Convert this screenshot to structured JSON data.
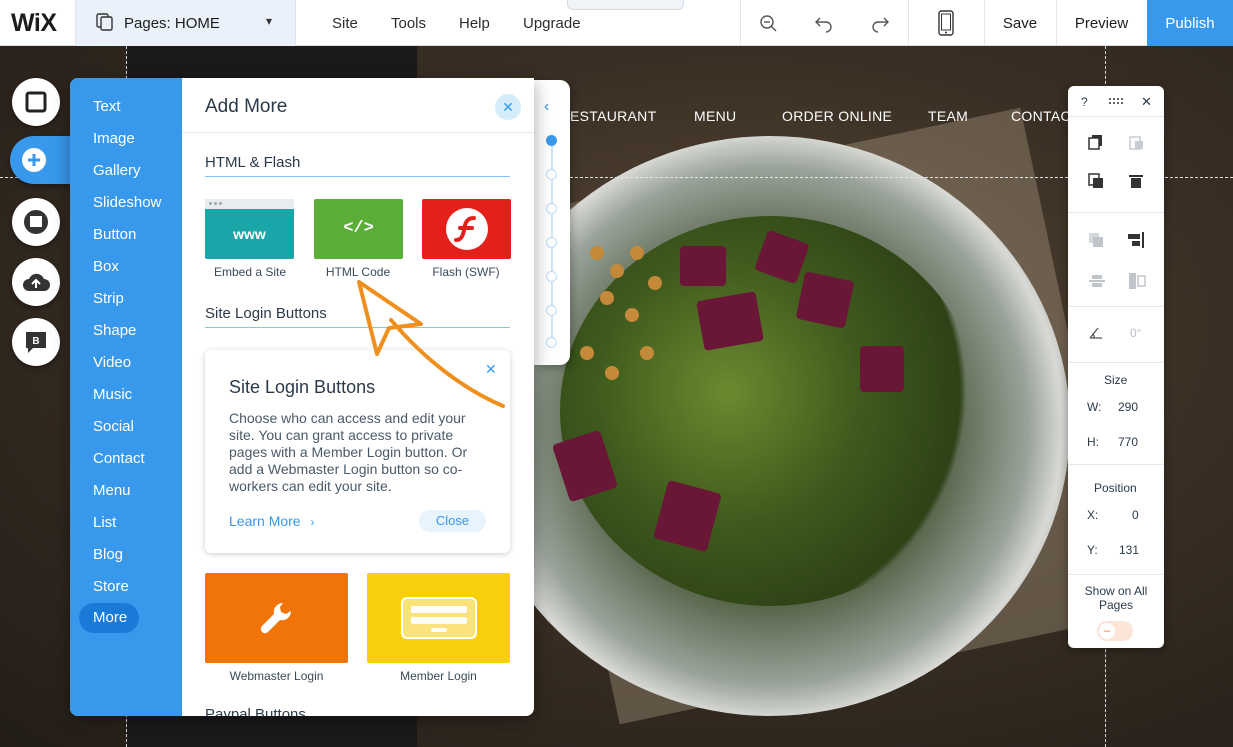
{
  "topbar": {
    "logo": "WiX",
    "pages_label": "Pages: HOME",
    "menu": [
      "Site",
      "Tools",
      "Help",
      "Upgrade"
    ],
    "save": "Save",
    "preview": "Preview",
    "publish": "Publish",
    "accent": "#3899ec"
  },
  "site_nav": [
    "ESTAURANT",
    "MENU",
    "ORDER ONLINE",
    "TEAM",
    "CONTACT"
  ],
  "rail": [
    "add-elements",
    "add",
    "store",
    "upload",
    "blog"
  ],
  "panel": {
    "title": "Add More",
    "categories": [
      "Text",
      "Image",
      "Gallery",
      "Slideshow",
      "Button",
      "Box",
      "Strip",
      "Shape",
      "Video",
      "Music",
      "Social",
      "Contact",
      "Menu",
      "List",
      "Blog",
      "Store",
      "More"
    ],
    "selected": "More",
    "sections": {
      "html_flash": "HTML & Flash",
      "site_login": "Site Login Buttons",
      "next": "Paypal Buttons"
    },
    "tiles": [
      {
        "label": "Embed a Site",
        "color": "#1aa6a8",
        "icon": "www"
      },
      {
        "label": "HTML Code",
        "color": "#5aae37",
        "icon": "</>"
      },
      {
        "label": "Flash (SWF)",
        "color": "#e4201a",
        "icon": "flash-icon"
      }
    ],
    "info_card": {
      "title": "Site Login Buttons",
      "body": "Choose who can access and edit your site. You can grant access to private pages with a Member Login button. Or add a Webmaster Login button so co-workers can edit your site.",
      "learn_more": "Learn More",
      "close": "Close"
    },
    "login_tiles": [
      {
        "label": "Webmaster Login",
        "color": "#f07408"
      },
      {
        "label": "Member Login",
        "color": "#f7cf0b"
      }
    ]
  },
  "inspector": {
    "help": "?",
    "angle": "0°",
    "size_title": "Size",
    "w_label": "W:",
    "w": "290",
    "h_label": "H:",
    "h": "770",
    "position_title": "Position",
    "x_label": "X:",
    "x": "0",
    "y_label": "Y:",
    "y": "131",
    "show_all": "Show on All Pages"
  }
}
